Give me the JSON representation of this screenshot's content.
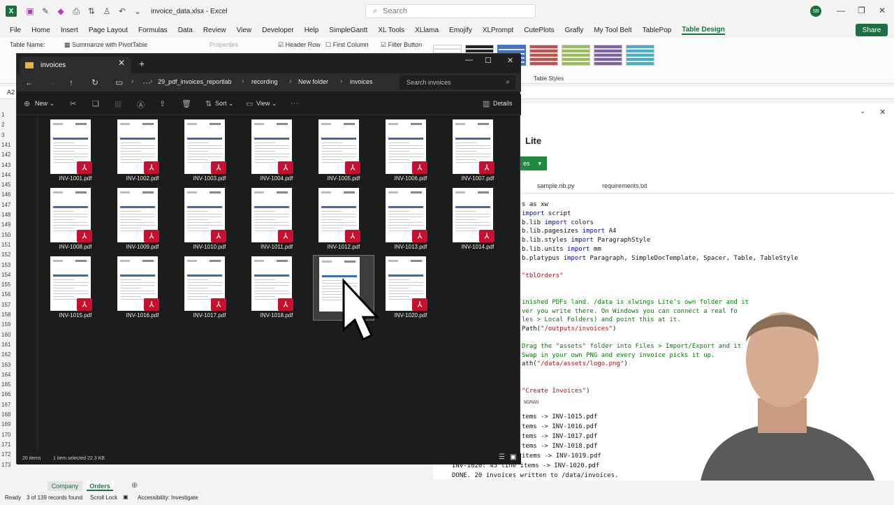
{
  "excel": {
    "window_title": "invoice_data.xlsx - Excel",
    "search_placeholder": "Search",
    "user_initials": "SB",
    "ribbon_tabs": [
      "File",
      "Home",
      "Insert",
      "Page Layout",
      "Formulas",
      "Data",
      "Review",
      "View",
      "Developer",
      "Help",
      "SimpleGantt",
      "XL Tools",
      "XLlama",
      "Emojify",
      "XLPrompt",
      "CutePlots",
      "Grafly",
      "My Tool Belt",
      "TablePop",
      "Table Design"
    ],
    "active_tab": "Table Design",
    "share_label": "Share",
    "ribbon": {
      "table_name_label": "Table Name:",
      "summarize_label": "Summarize with PivotTable",
      "properties_label": "Properties",
      "header_row_label": "Header Row",
      "first_column_label": "First Column",
      "filter_button_label": "Filter Button",
      "table_styles_label": "Table Styles"
    },
    "name_box": "A2",
    "row_numbers": [
      "1",
      "2",
      "3",
      "141",
      "142",
      "143",
      "144",
      "145",
      "146",
      "147",
      "148",
      "149",
      "150",
      "151",
      "152",
      "153",
      "154",
      "155",
      "156",
      "157",
      "158",
      "159",
      "160",
      "161",
      "162",
      "163",
      "164",
      "165",
      "166",
      "167",
      "168",
      "169",
      "170",
      "171",
      "172",
      "173"
    ],
    "sheet_tabs": [
      "Company",
      "Orders"
    ],
    "active_sheet": "Orders",
    "status": {
      "ready": "Ready",
      "records": "3 of 139 records found",
      "scroll_lock": "Scroll Lock",
      "accessibility": "Accessibility: Investigate"
    }
  },
  "xlwings": {
    "title": "Lite",
    "run_label": "es",
    "file_tabs": [
      "sample.nb.py",
      "requirements.txt"
    ],
    "code_lines": [
      {
        "parts": [
          {
            "t": "s as xw",
            "c": ""
          }
        ]
      },
      {
        "parts": [
          {
            "t": "import",
            "c": "kw"
          },
          {
            "t": " script",
            "c": ""
          }
        ]
      },
      {
        "parts": [
          {
            "t": "b.lib ",
            "c": ""
          },
          {
            "t": "import",
            "c": "kw"
          },
          {
            "t": " colors",
            "c": ""
          }
        ]
      },
      {
        "parts": [
          {
            "t": "b.lib.pagesizes ",
            "c": ""
          },
          {
            "t": "import",
            "c": "kw"
          },
          {
            "t": " A4",
            "c": ""
          }
        ]
      },
      {
        "parts": [
          {
            "t": "b.lib.styles ",
            "c": ""
          },
          {
            "t": "import",
            "c": "kw"
          },
          {
            "t": " ParagraphStyle",
            "c": ""
          }
        ]
      },
      {
        "parts": [
          {
            "t": "b.lib.units ",
            "c": ""
          },
          {
            "t": "import",
            "c": "kw"
          },
          {
            "t": " mm",
            "c": ""
          }
        ]
      },
      {
        "parts": [
          {
            "t": "b.platypus ",
            "c": ""
          },
          {
            "t": "import",
            "c": "kw"
          },
          {
            "t": " Paragraph, SimpleDocTemplate, Spacer, Table, TableStyle",
            "c": ""
          }
        ]
      },
      {
        "parts": [
          {
            "t": "\"tblOrders\"",
            "c": "str"
          }
        ]
      },
      {
        "parts": [
          {
            "t": "inished PDFs land. /data is xlwings Lite's own folder and it",
            "c": "cmt"
          }
        ]
      },
      {
        "parts": [
          {
            "t": "ver you write there. On Windows you can connect a real fo",
            "c": "cmt"
          }
        ]
      },
      {
        "parts": [
          {
            "t": "les > Local Folders) and point this at it.",
            "c": "cmt"
          }
        ]
      },
      {
        "parts": [
          {
            "t": "Path(",
            "c": ""
          },
          {
            "t": "\"/outputs/invoices\"",
            "c": "str"
          },
          {
            "t": ")",
            "c": ""
          }
        ]
      },
      {
        "parts": [
          {
            "t": "Drag the \"assets\" folder into Files > Import/Export and it",
            "c": "cmt"
          }
        ]
      },
      {
        "parts": [
          {
            "t": " Swap in your own PNG and every invoice picks it up.",
            "c": "cmt"
          }
        ]
      },
      {
        "parts": [
          {
            "t": "ath(",
            "c": ""
          },
          {
            "t": "\"/data/assets/logo.png\"",
            "c": "str"
          },
          {
            "t": ")",
            "c": ""
          }
        ]
      },
      {
        "parts": [
          {
            "t": "\"Create Invoices\"",
            "c": "str"
          },
          {
            "t": ")",
            "c": ""
          }
        ]
      }
    ],
    "output_header": "NGMAN",
    "output_lines": [
      "tems -> INV-1015.pdf",
      "tems -> INV-1016.pdf",
      "tems -> INV-1017.pdf",
      "tems -> INV-1018.pdf",
      "items -> INV-1019.pdf",
      "INV-1020: 45 line items -> INV-1020.pdf",
      "DONE. 20 invoices written to /data/invoices."
    ]
  },
  "explorer": {
    "tab_title": "invoices",
    "breadcrumbs": [
      "29_pdf_invoices_reportlab",
      "recording",
      "New folder",
      "invoices"
    ],
    "search_placeholder": "Search invoices",
    "toolbar": {
      "new_label": "New",
      "sort_label": "Sort",
      "view_label": "View",
      "details_label": "Details"
    },
    "files": [
      "INV-1001.pdf",
      "INV-1002.pdf",
      "INV-1003.pdf",
      "INV-1004.pdf",
      "INV-1005.pdf",
      "INV-1006.pdf",
      "INV-1007.pdf",
      "INV-1008.pdf",
      "INV-1009.pdf",
      "INV-1010.pdf",
      "INV-1011.pdf",
      "INV-1012.pdf",
      "INV-1013.pdf",
      "INV-1014.pdf",
      "INV-1015.pdf",
      "INV-1016.pdf",
      "INV-1017.pdf",
      "INV-1018.pdf",
      "INV-1019.pdf",
      "INV-1020.pdf"
    ],
    "selected_file": "INV-1019.pdf",
    "status": {
      "item_count": "20 items",
      "selection": "1 item selected 22.3 KB"
    }
  }
}
